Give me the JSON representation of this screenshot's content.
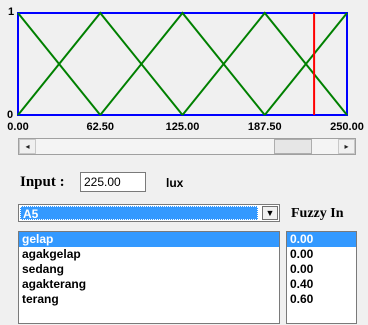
{
  "plot": {
    "y_max_label": "1",
    "y_min_label": "0",
    "x_ticks": [
      "0.00",
      "62.50",
      "125.00",
      "187.50",
      "250.00"
    ],
    "x_range": [
      0,
      250
    ],
    "memberships": [
      {
        "name": "gelap",
        "points": [
          [
            0,
            1
          ],
          [
            62.5,
            0
          ]
        ]
      },
      {
        "name": "agakgelap",
        "points": [
          [
            0,
            0
          ],
          [
            62.5,
            1
          ],
          [
            125,
            0
          ]
        ]
      },
      {
        "name": "sedang",
        "points": [
          [
            62.5,
            0
          ],
          [
            125,
            1
          ],
          [
            187.5,
            0
          ]
        ]
      },
      {
        "name": "agakterang",
        "points": [
          [
            125,
            0
          ],
          [
            187.5,
            1
          ],
          [
            250,
            0
          ]
        ]
      },
      {
        "name": "terang",
        "points": [
          [
            187.5,
            0
          ],
          [
            250,
            1
          ]
        ]
      }
    ],
    "marker_x": 225,
    "colors": {
      "border": "#0000ff",
      "curves": "#008000",
      "marker": "#ff0000"
    }
  },
  "slider": {
    "left_arrow": "◂",
    "right_arrow": "▸",
    "value_fraction": 0.9
  },
  "input": {
    "label": "Input :",
    "value": "225.00",
    "unit": "lux"
  },
  "select": {
    "value": "A5",
    "arrow": "▼"
  },
  "fuzzy": {
    "label": "Fuzzy In",
    "sets": [
      "gelap",
      "agakgelap",
      "sedang",
      "agakterang",
      "terang"
    ],
    "values": [
      "0.00",
      "0.00",
      "0.00",
      "0.40",
      "0.60"
    ],
    "selected_index": 0
  }
}
